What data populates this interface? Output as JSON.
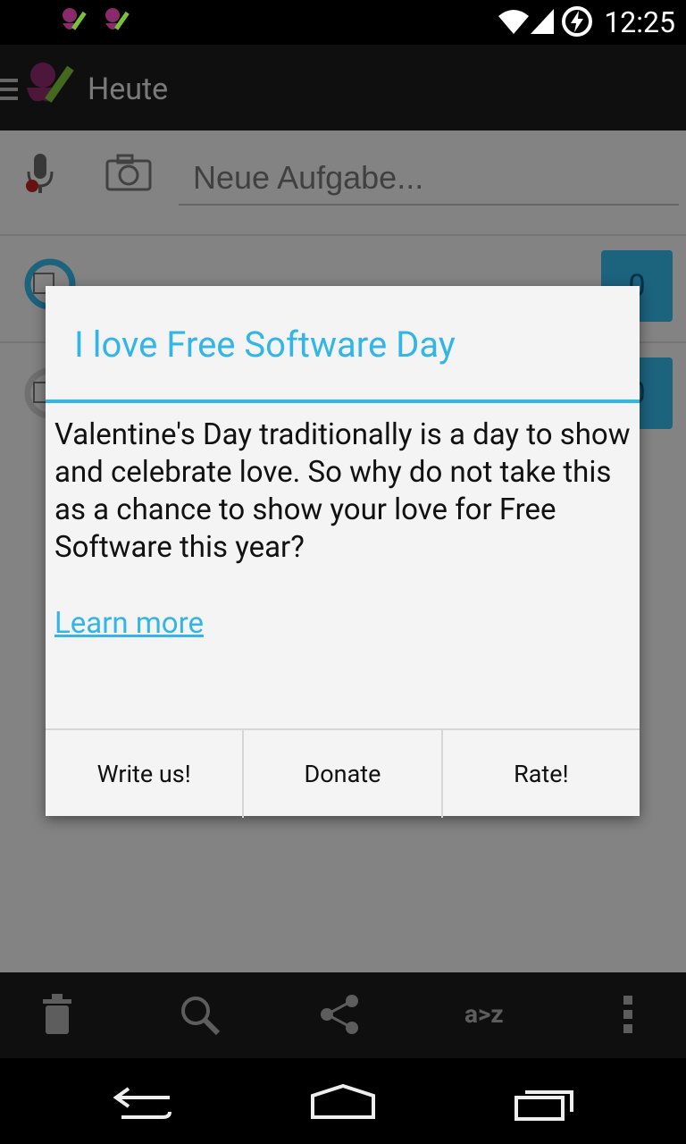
{
  "status_bar": {
    "time": "12:25"
  },
  "app": {
    "title": "Heute"
  },
  "input": {
    "placeholder": "Neue Aufgabe..."
  },
  "task_counts": [
    "0",
    "0"
  ],
  "dialog": {
    "title": "I love Free Software Day",
    "body": "Valentine's Day traditionally is a day to show and celebrate love. So why do not take this as a chance to show your love for Free Software this year?",
    "link": "Learn more",
    "buttons": {
      "write": "Write us!",
      "donate": "Donate",
      "rate": "Rate!"
    }
  },
  "colors": {
    "accent": "#33b5e5"
  },
  "bottom_bar": {
    "icons": [
      "trash-icon",
      "search-icon",
      "share-icon",
      "sort-az-icon",
      "overflow-menu-icon"
    ],
    "sort_label": "a>z"
  }
}
